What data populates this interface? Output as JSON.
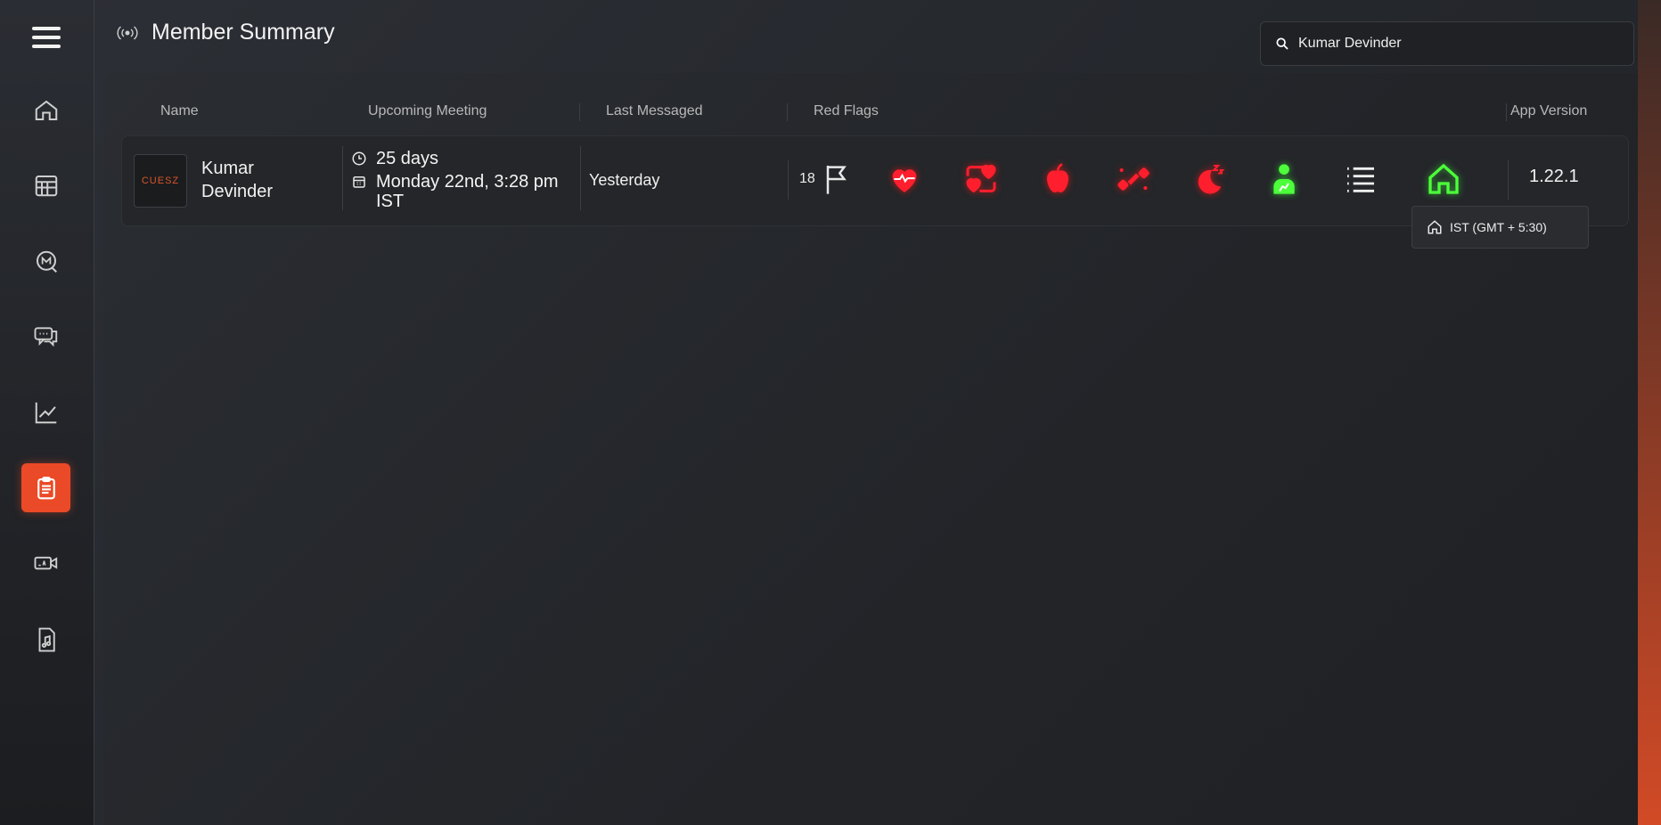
{
  "header": {
    "title": "Member Summary"
  },
  "search": {
    "value": "Kumar Devinder"
  },
  "columns": {
    "name": "Name",
    "upcoming_meeting": "Upcoming Meeting",
    "last_messaged": "Last Messaged",
    "red_flags": "Red Flags",
    "app_version": "App Version"
  },
  "member": {
    "avatar_text": "CUESZ",
    "name": "Kumar Devinder",
    "meeting_countdown": "25 days",
    "meeting_date": "Monday 22nd, 3:28 pm",
    "meeting_tz": "IST",
    "last_messaged": "Yesterday",
    "red_flag_count": "18",
    "app_version": "1.22.1",
    "timezone_tooltip": "IST (GMT + 5:30)"
  },
  "colors": {
    "accent": "#ea4a27",
    "flag_red": "#ff1e2d",
    "status_green": "#4cff3a"
  },
  "sidebar": {
    "items": [
      {
        "icon": "home-icon"
      },
      {
        "icon": "calendar-icon"
      },
      {
        "icon": "message-m-icon"
      },
      {
        "icon": "chat-icon"
      },
      {
        "icon": "trend-chart-icon"
      },
      {
        "icon": "clipboard-icon",
        "active": true
      },
      {
        "icon": "video-call-icon"
      },
      {
        "icon": "audio-file-icon"
      }
    ]
  }
}
